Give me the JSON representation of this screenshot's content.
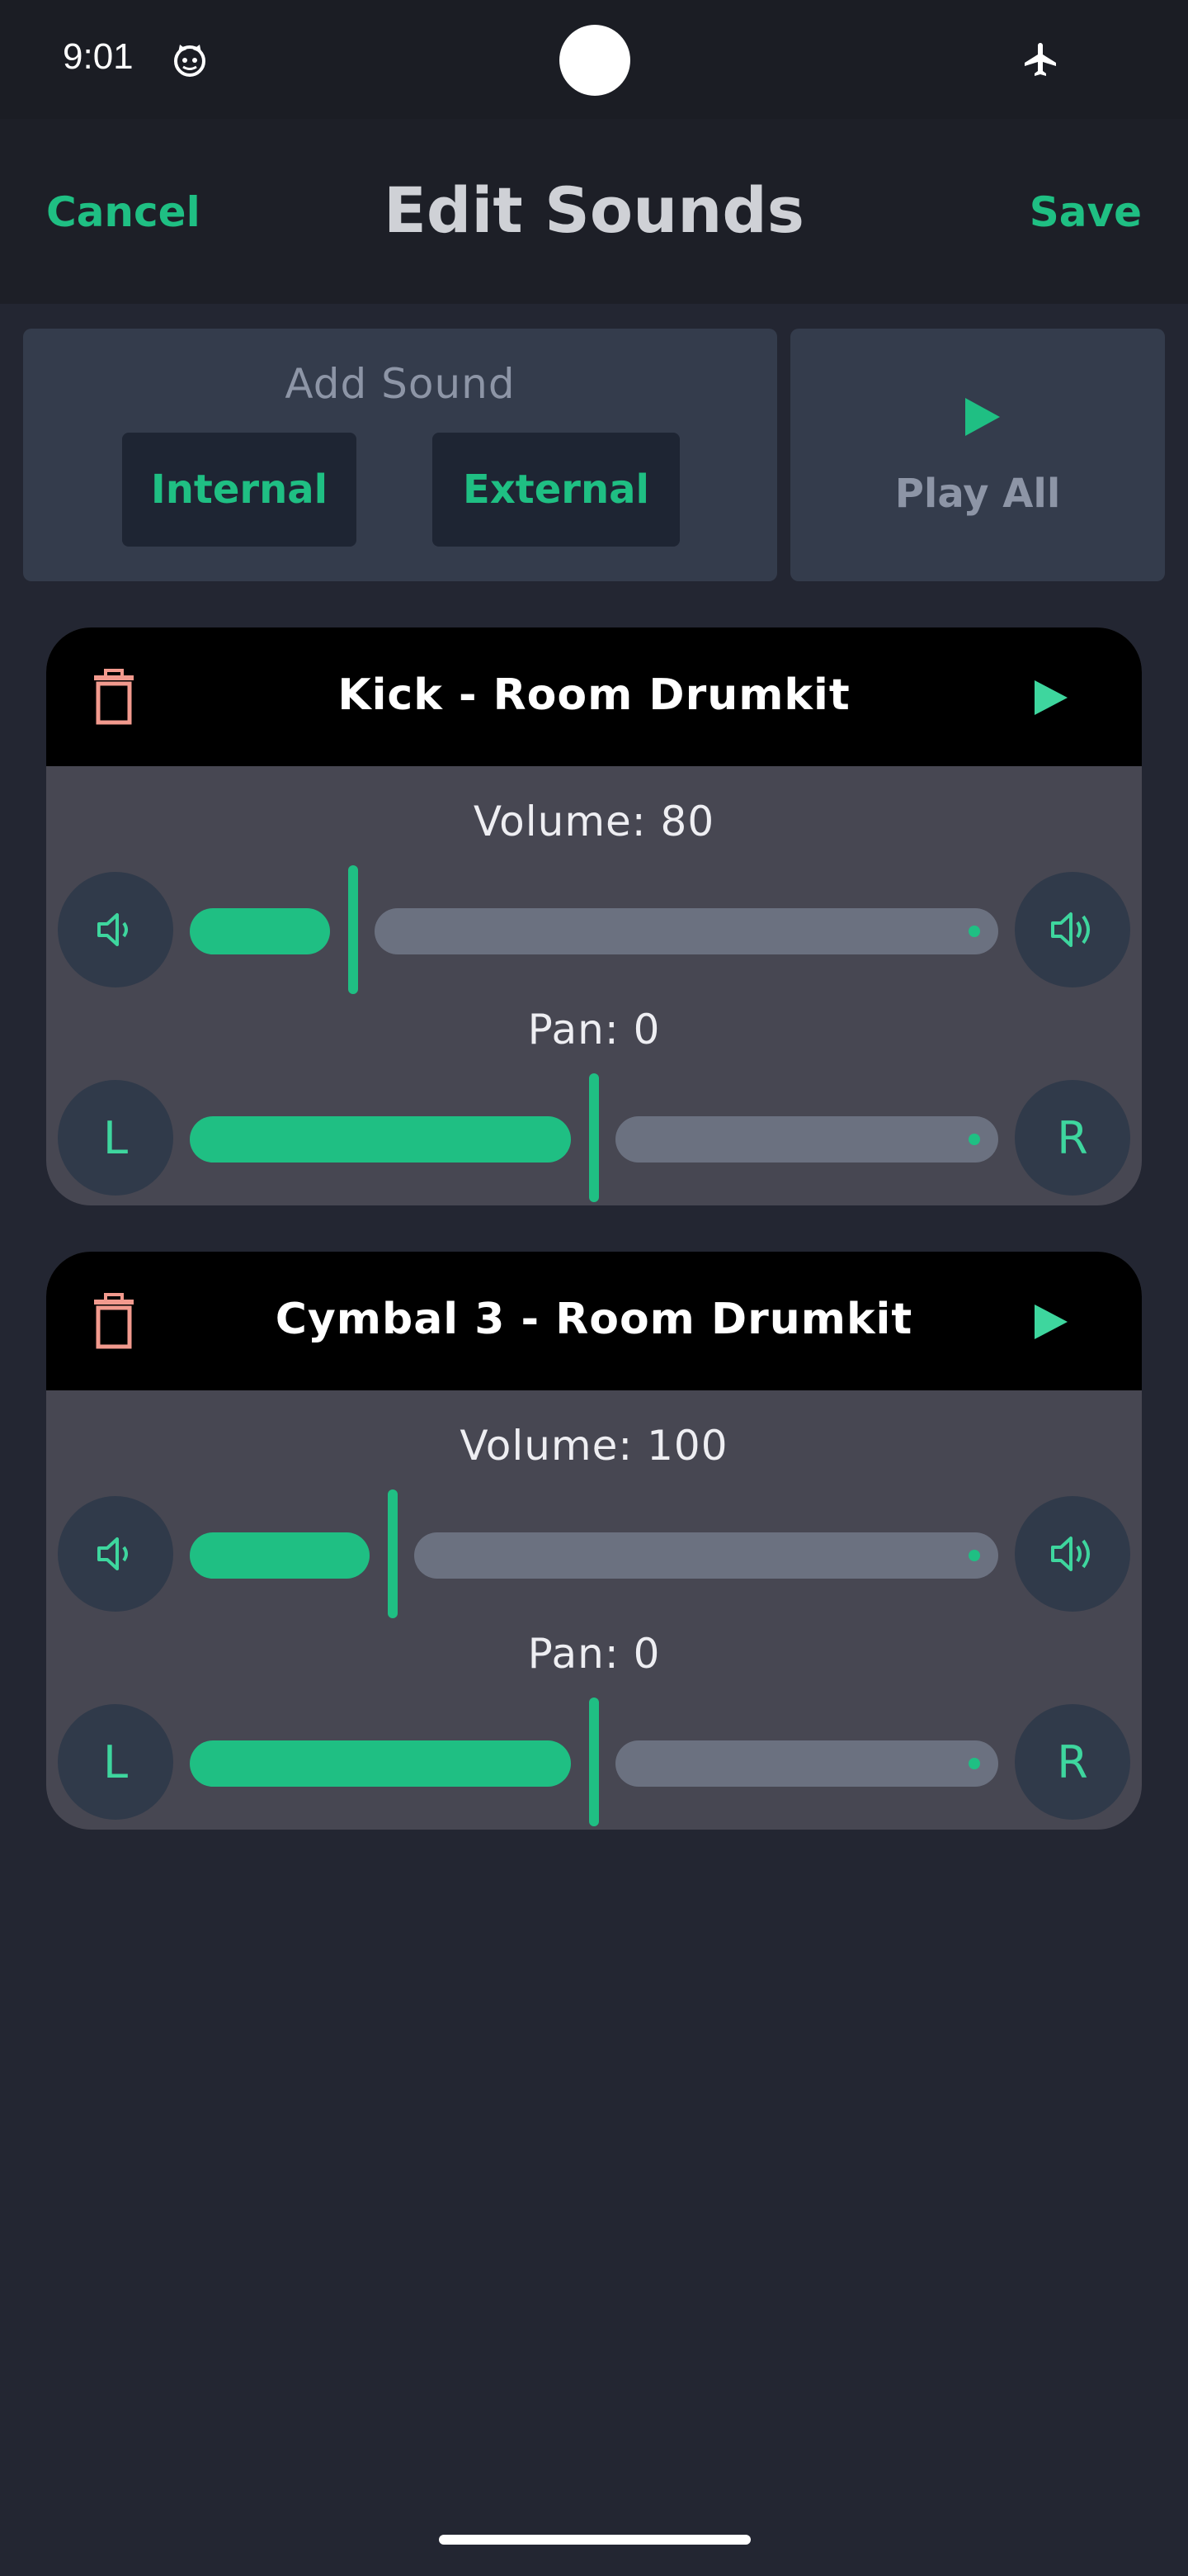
{
  "status_bar": {
    "time": "9:01"
  },
  "app_bar": {
    "cancel_label": "Cancel",
    "title": "Edit Sounds",
    "save_label": "Save"
  },
  "add_sound": {
    "title": "Add Sound",
    "internal_label": "Internal",
    "external_label": "External"
  },
  "play_all": {
    "label": "Play All"
  },
  "sounds": [
    {
      "name": "Kick - Room Drumkit",
      "volume_label": "Volume: 80",
      "volume": 80,
      "pan_label": "Pan: 0",
      "pan": 0,
      "left_label": "L",
      "right_label": "R"
    },
    {
      "name": "Cymbal 3 - Room Drumkit",
      "volume_label": "Volume: 100",
      "volume": 100,
      "pan_label": "Pan: 0",
      "pan": 0,
      "left_label": "L",
      "right_label": "R"
    }
  ],
  "colors": {
    "accent": "#1fbf83",
    "trash": "#f29a8e",
    "card": "#474752",
    "background": "#232632"
  }
}
